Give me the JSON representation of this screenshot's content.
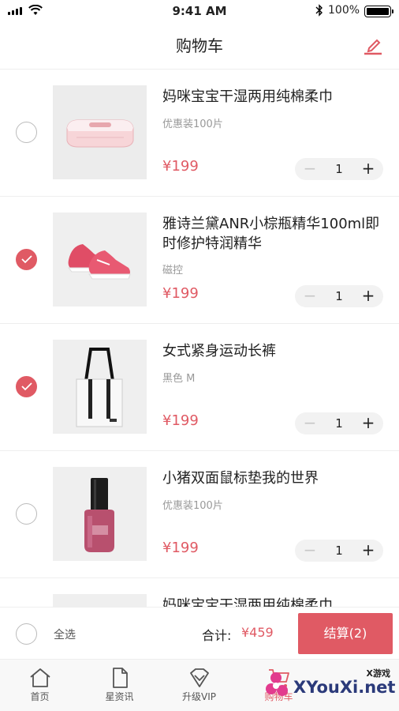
{
  "status_bar": {
    "time": "9:41 AM",
    "battery": "100%"
  },
  "header": {
    "title": "购物车"
  },
  "cart": {
    "items": [
      {
        "title": "妈咪宝宝干湿两用纯棉柔巾",
        "spec": "优惠装100片",
        "price": "¥199",
        "quantity": "1",
        "selected": false,
        "image": "wipes-box"
      },
      {
        "title": "雅诗兰黛ANR小棕瓶精华100ml即时修护特润精华",
        "spec": "磁控",
        "price": "¥199",
        "quantity": "1",
        "selected": true,
        "image": "pink-sneakers"
      },
      {
        "title": "女式紧身运动长裤",
        "spec": "黑色 M",
        "price": "¥199",
        "quantity": "1",
        "selected": true,
        "image": "tote-bag"
      },
      {
        "title": "小猪双面鼠标垫我的世界",
        "spec": "优惠装100片",
        "price": "¥199",
        "quantity": "1",
        "selected": false,
        "image": "nail-polish"
      },
      {
        "title": "妈咪宝宝干湿两用纯棉柔巾",
        "spec": "",
        "price": "",
        "quantity": "",
        "selected": false,
        "image": ""
      }
    ],
    "stepper": {
      "minus": "−",
      "plus": "+"
    }
  },
  "checkout": {
    "select_all": "全选",
    "total_label": "合计:",
    "total_amount": "¥459",
    "button_label": "结算(2)"
  },
  "tabs": [
    {
      "label": "首页",
      "icon": "home-icon"
    },
    {
      "label": "星资讯",
      "icon": "document-icon"
    },
    {
      "label": "升级VIP",
      "icon": "diamond-icon"
    },
    {
      "label": "购物车",
      "icon": "cart-icon"
    }
  ],
  "watermark": {
    "tag": "X游戏",
    "text": "XYouXi.net"
  },
  "colors": {
    "accent": "#e05a64",
    "divider": "#eeeeee",
    "muted": "#999999"
  }
}
